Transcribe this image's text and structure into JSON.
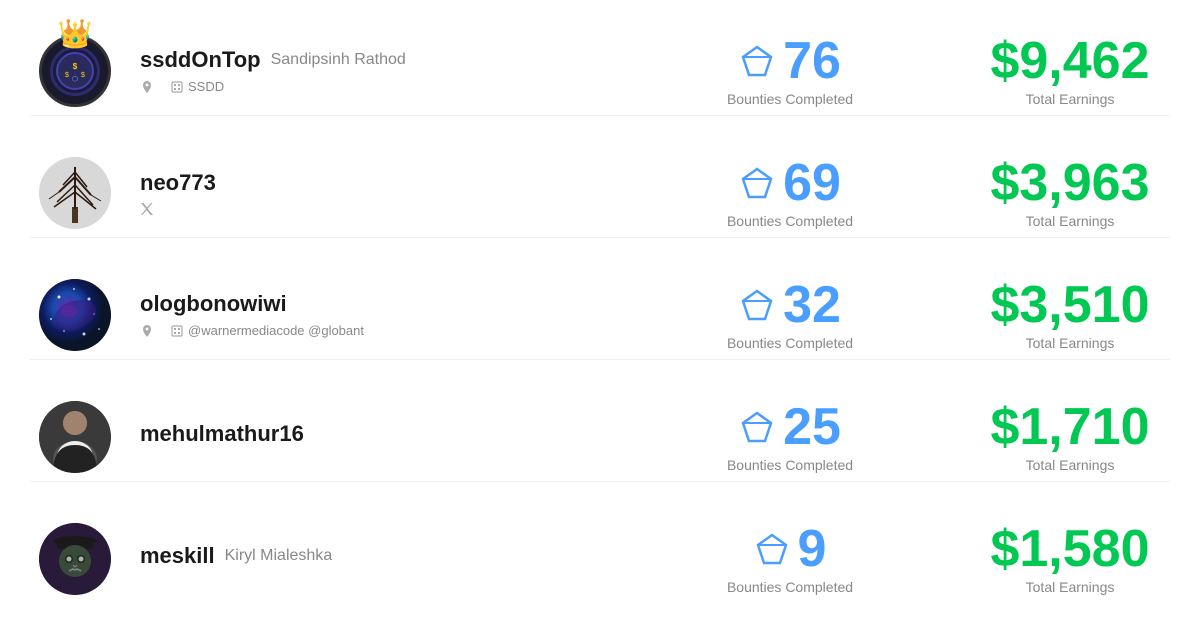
{
  "leaderboard": {
    "users": [
      {
        "username": "ssddOnTop",
        "real_name": "Sandipsinh Rathod",
        "organization": "SSDD",
        "has_location": true,
        "has_org": true,
        "bounties": "76",
        "bounties_label": "Bounties Completed",
        "earnings": "$9,462",
        "earnings_label": "Total Earnings",
        "avatar_type": "1",
        "has_crown": true,
        "social": ""
      },
      {
        "username": "neo773",
        "real_name": "",
        "organization": "",
        "has_location": false,
        "has_org": false,
        "bounties": "69",
        "bounties_label": "Bounties Completed",
        "earnings": "$3,963",
        "earnings_label": "Total Earnings",
        "avatar_type": "2",
        "has_crown": false,
        "social": "x"
      },
      {
        "username": "ologbonowiwi",
        "real_name": "",
        "organization": "@warnermediacode @globant",
        "has_location": true,
        "has_org": true,
        "bounties": "32",
        "bounties_label": "Bounties Completed",
        "earnings": "$3,510",
        "earnings_label": "Total Earnings",
        "avatar_type": "3",
        "has_crown": false,
        "social": ""
      },
      {
        "username": "mehulmathur16",
        "real_name": "",
        "organization": "",
        "has_location": false,
        "has_org": false,
        "bounties": "25",
        "bounties_label": "Bounties Completed",
        "earnings": "$1,710",
        "earnings_label": "Total Earnings",
        "avatar_type": "4",
        "has_crown": false,
        "social": ""
      },
      {
        "username": "meskill",
        "real_name": "Kiryl Mialeshka",
        "organization": "",
        "has_location": false,
        "has_org": false,
        "bounties": "9",
        "bounties_label": "Bounties Completed",
        "earnings": "$1,580",
        "earnings_label": "Total Earnings",
        "avatar_type": "5",
        "has_crown": false,
        "social": ""
      }
    ]
  },
  "icons": {
    "location": "📍",
    "building": "🏢",
    "x_social": "✕",
    "crown": "👑",
    "diamond": "◇"
  }
}
